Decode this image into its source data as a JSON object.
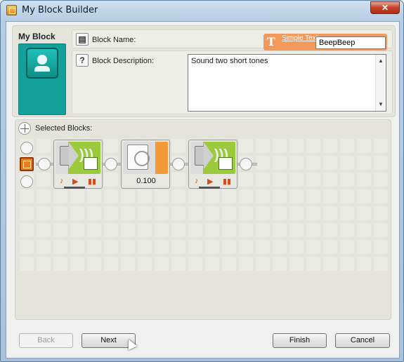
{
  "window": {
    "title": "My Block Builder",
    "close_label": "✕"
  },
  "header": {
    "heading": "My Block"
  },
  "block_name": {
    "label": "Block Name:",
    "value": "BeepBeep",
    "simple_text_label": "Simple Text",
    "icon": "text-t-icon"
  },
  "block_description": {
    "label": "Block Description:",
    "value": "Sound two short tones",
    "icon": "question-icon"
  },
  "selected": {
    "label": "Selected Blocks:",
    "blocks": [
      {
        "type": "sound",
        "icon": "speaker-icon"
      },
      {
        "type": "wait",
        "icon": "hourglass-icon",
        "value": "0.100"
      },
      {
        "type": "sound",
        "icon": "speaker-icon"
      }
    ]
  },
  "footer": {
    "back": "Back",
    "next": "Next",
    "finish": "Finish",
    "cancel": "Cancel"
  },
  "colors": {
    "accent_orange": "#f29a5c",
    "block_teal": "#14a09a",
    "sound_green": "#9bcb3c"
  }
}
